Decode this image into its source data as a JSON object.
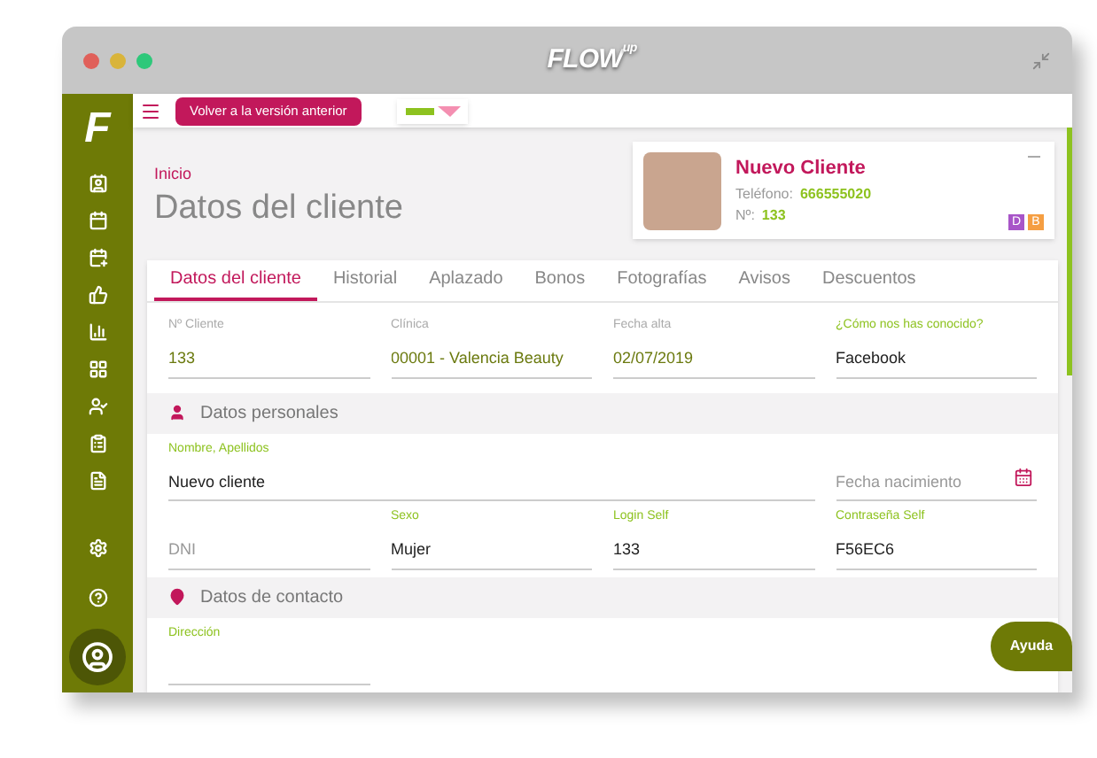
{
  "window": {
    "title_logo": "FLOW",
    "title_logo_sup": "up"
  },
  "sidebar": {
    "logo": "F",
    "items": [
      {
        "selected": false
      },
      {
        "selected": false
      },
      {
        "selected": false
      },
      {
        "selected": false
      },
      {
        "selected": false
      },
      {
        "selected": false
      },
      {
        "selected": false
      },
      {
        "selected": false
      },
      {
        "selected": false
      }
    ],
    "bottom_items": [
      {
        "selected": false
      },
      {
        "selected": false
      },
      {
        "selected": true
      }
    ]
  },
  "topbar": {
    "back_button": "Volver a la versión anterior"
  },
  "breadcrumb": "Inicio",
  "page_title": "Datos del cliente",
  "client_card": {
    "name": "Nuevo Cliente",
    "phone_label": "Teléfono:",
    "phone": "666555020",
    "number_label": "Nº:",
    "number": "133",
    "badges": [
      {
        "label": "D",
        "color": "#a855c8"
      },
      {
        "label": "B",
        "color": "#f59e42"
      }
    ]
  },
  "tabs": [
    {
      "label": "Datos del cliente",
      "selected": true
    },
    {
      "label": "Historial",
      "selected": false
    },
    {
      "label": "Aplazado",
      "selected": false
    },
    {
      "label": "Bonos",
      "selected": false
    },
    {
      "label": "Fotografías",
      "selected": false
    },
    {
      "label": "Avisos",
      "selected": false
    },
    {
      "label": "Descuentos",
      "selected": false
    }
  ],
  "general_fields": [
    {
      "kind": "readonly",
      "label": "Nº Cliente",
      "value": "133"
    },
    {
      "kind": "readonly",
      "label": "Clínica",
      "value": "00001 - Valencia Beauty"
    },
    {
      "kind": "readonly",
      "label": "Fecha alta",
      "value": "02/07/2019"
    },
    {
      "kind": "input",
      "label": "¿Cómo nos has conocido?",
      "value": "Facebook"
    }
  ],
  "sections": [
    {
      "title": "Datos personales",
      "fields": [
        {
          "kind": "wide",
          "label": "Nombre, Apellidos",
          "value": "Nuevo cliente"
        },
        {
          "kind": "date",
          "placeholder": "Fecha nacimiento"
        },
        {
          "kind": "input",
          "placeholder": "DNI"
        },
        {
          "kind": "input",
          "label": "Sexo",
          "value": "Mujer"
        },
        {
          "kind": "input",
          "label": "Login Self",
          "value": "133"
        },
        {
          "kind": "input",
          "label": "Contraseña Self",
          "value": "F56EC6"
        }
      ]
    },
    {
      "title": "Datos de contacto",
      "fields": [
        {
          "kind": "input",
          "label": "Dirección"
        }
      ]
    }
  ],
  "help_button": "Ayuda"
}
